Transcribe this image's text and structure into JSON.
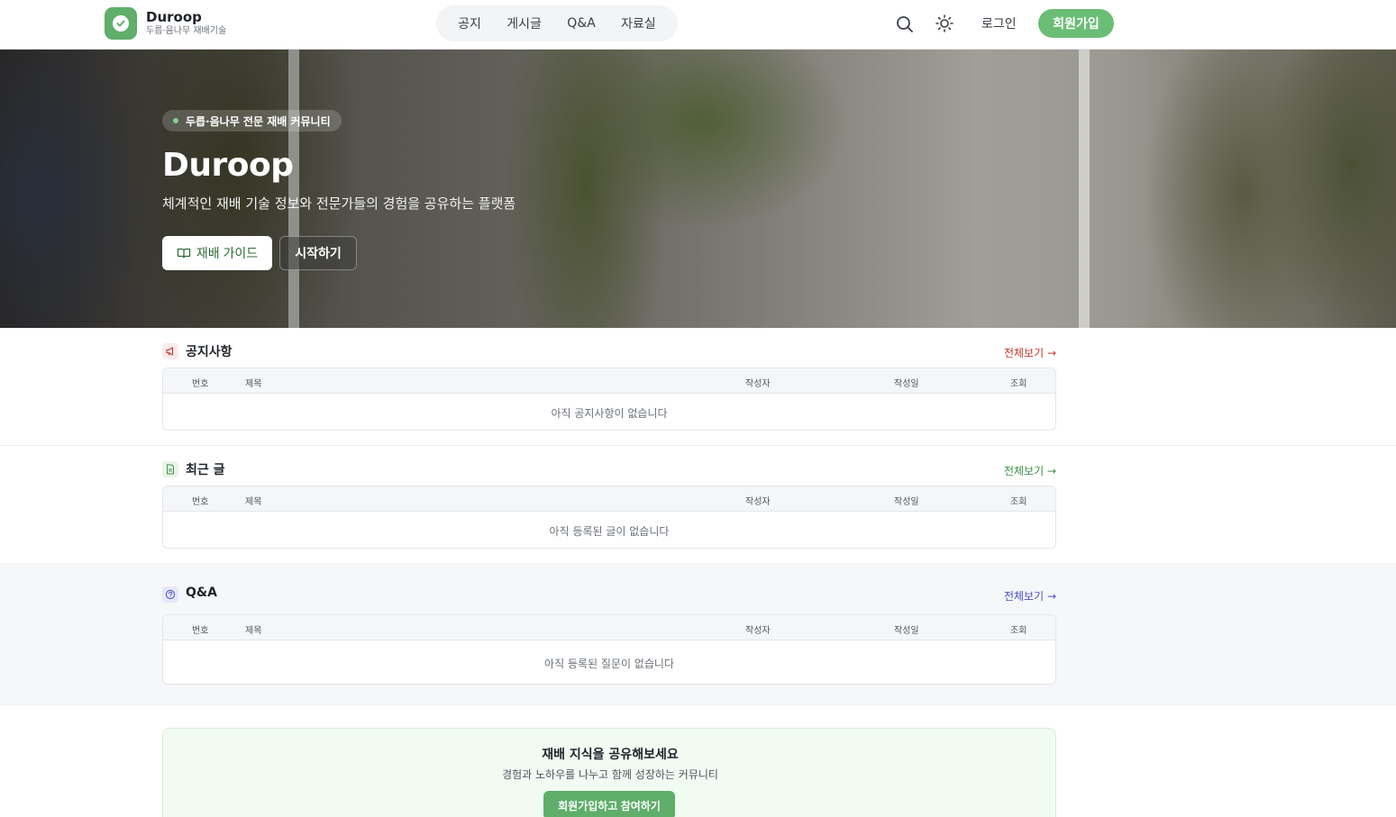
{
  "brand": {
    "title": "Duroop",
    "subtitle": "두릅·음나무 재배기술"
  },
  "nav": [
    {
      "label": "공지"
    },
    {
      "label": "게시글"
    },
    {
      "label": "Q&A"
    },
    {
      "label": "자료실"
    }
  ],
  "header": {
    "login": "로그인",
    "signup": "회원가입"
  },
  "hero": {
    "badge": "두릅·음나무 전문 재배 커뮤니티",
    "title": "Duroop",
    "subtitle": "체계적인 재배 기술 정보와 전문가들의 경험을 공유하는 플랫폼",
    "guide_button": "재배 가이드",
    "start_button": "시작하기"
  },
  "table_columns": {
    "no": "번호",
    "title": "제목",
    "author": "작성자",
    "date": "작성일",
    "views": "조회"
  },
  "sections": {
    "notice": {
      "title": "공지사항",
      "more": "전체보기 →",
      "empty": "아직 공지사항이 없습니다",
      "accent": "#c0392b"
    },
    "recent": {
      "title": "최근 글",
      "more": "전체보기 →",
      "empty": "아직 등록된 글이 없습니다",
      "accent": "#3f8f4a"
    },
    "qna": {
      "title": "Q&A",
      "more": "전체보기 →",
      "empty": "아직 등록된 질문이 없습니다",
      "accent": "#4a4fc9"
    }
  },
  "cta": {
    "title": "재배 지식을 공유해보세요",
    "subtitle": "경험과 노하우를 나누고 함께 성장하는 커뮤니티",
    "button": "회원가입하고 참여하기"
  },
  "colors": {
    "brand_green": "#6bbd76",
    "notice_red": "#c0392b",
    "recent_green": "#3f8f4a",
    "qna_blue": "#4a4fc9"
  }
}
